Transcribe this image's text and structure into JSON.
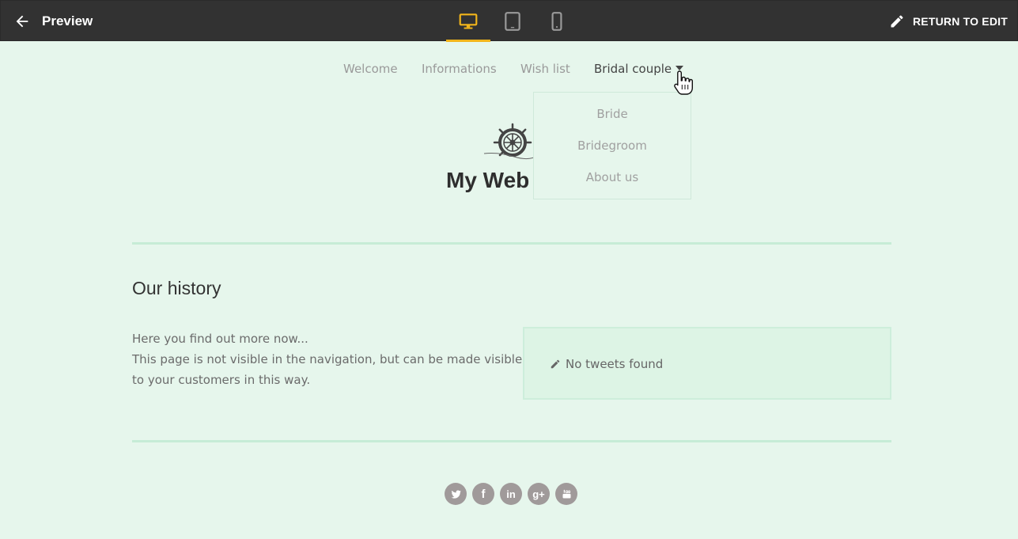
{
  "preview_bar": {
    "back_label": "Preview",
    "devices": [
      {
        "name": "desktop-icon",
        "active": true
      },
      {
        "name": "tablet-icon",
        "active": false
      },
      {
        "name": "mobile-icon",
        "active": false
      }
    ],
    "return_label": "RETURN TO EDIT",
    "accent_color": "#f2b51b"
  },
  "nav": {
    "items": [
      {
        "label": "Welcome"
      },
      {
        "label": "Informations"
      },
      {
        "label": "Wish list"
      },
      {
        "label": "Bridal couple"
      }
    ],
    "dropdown": [
      {
        "label": "Bride"
      },
      {
        "label": "Bridegroom"
      },
      {
        "label": "About us"
      }
    ]
  },
  "header": {
    "logo_icon": "ship-wheel-icon",
    "site_title": "My Web"
  },
  "content": {
    "section_title": "Our history",
    "paragraph_lines": [
      "Here you find out more now...",
      "This page is not visible in the navigation, but can be made visible",
      "to your customers in this way."
    ],
    "tweets_message": "No tweets found"
  },
  "footer": {
    "social": [
      {
        "name": "twitter-icon"
      },
      {
        "name": "facebook-icon",
        "glyph": "f"
      },
      {
        "name": "linkedin-icon",
        "glyph": "in"
      },
      {
        "name": "google-plus-icon",
        "glyph": "g+"
      },
      {
        "name": "youtube-icon"
      }
    ]
  },
  "colors": {
    "page_background": "#e6f6ec",
    "topbar_background": "#323232",
    "divider": "#c6ecd6"
  }
}
